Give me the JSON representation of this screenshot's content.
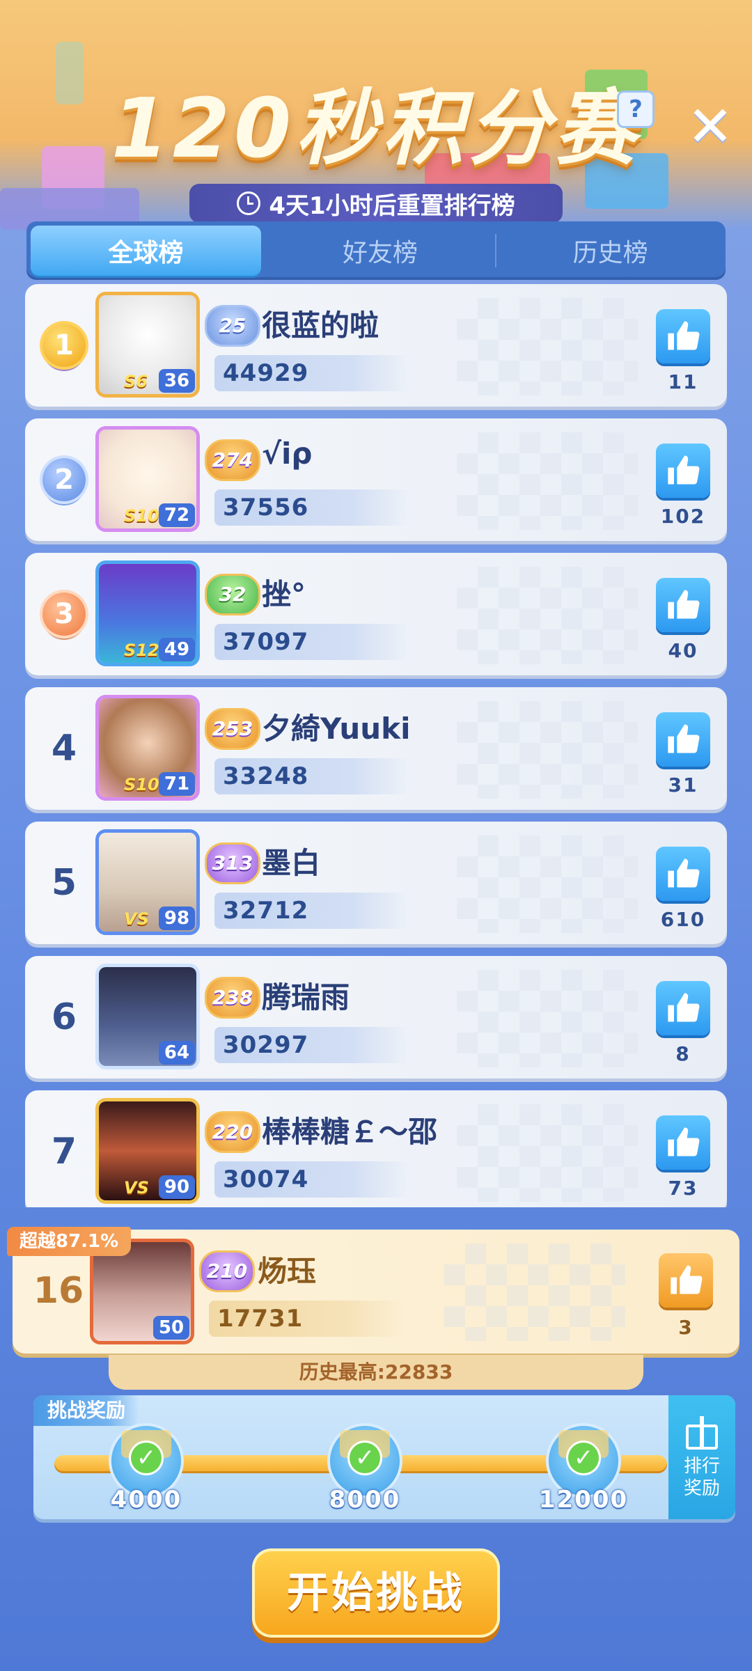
{
  "header": {
    "title": "120秒积分赛",
    "help_label": "?",
    "close_label": "✕",
    "reset_text": "4天1小时后重置排行榜"
  },
  "tabs": [
    {
      "label": "全球榜",
      "active": true
    },
    {
      "label": "好友榜",
      "active": false
    },
    {
      "label": "历史榜",
      "active": false
    }
  ],
  "leaderboard": [
    {
      "rank": "1",
      "medal": "gold",
      "level": "36",
      "season": "S6",
      "badge": "25",
      "badge_color": "blue",
      "name": "很蓝的啦",
      "score": "44929",
      "likes": "11"
    },
    {
      "rank": "2",
      "medal": "silver",
      "level": "72",
      "season": "S10",
      "badge": "274",
      "badge_color": "gold",
      "name": "√iρ",
      "score": "37556",
      "likes": "102"
    },
    {
      "rank": "3",
      "medal": "bronze",
      "level": "49",
      "season": "S12",
      "badge": "32",
      "badge_color": "green",
      "name": "挫°",
      "score": "37097",
      "likes": "40"
    },
    {
      "rank": "4",
      "medal": "",
      "level": "71",
      "season": "S10",
      "badge": "253",
      "badge_color": "gold",
      "name": "夕綺Yuuki",
      "score": "33248",
      "likes": "31"
    },
    {
      "rank": "5",
      "medal": "",
      "level": "98",
      "season": "VS",
      "badge": "313",
      "badge_color": "purple",
      "name": "墨白",
      "score": "32712",
      "likes": "610"
    },
    {
      "rank": "6",
      "medal": "",
      "level": "64",
      "season": "",
      "badge": "238",
      "badge_color": "gold",
      "name": "腾瑞雨",
      "score": "30297",
      "likes": "8"
    },
    {
      "rank": "7",
      "medal": "",
      "level": "90",
      "season": "VS",
      "badge": "220",
      "badge_color": "gold",
      "name": "棒棒糖￡～邵",
      "score": "30074",
      "likes": "73"
    }
  ],
  "me": {
    "surpass": "超越87.1%",
    "rank": "16",
    "level": "50",
    "badge": "210",
    "name": "炀珏",
    "score": "17731",
    "likes": "3",
    "history_best": "历史最高:22833"
  },
  "rewards": {
    "title": "挑战奖励",
    "milestones": [
      "4000",
      "8000",
      "12000"
    ],
    "rank_reward_line1": "排行",
    "rank_reward_line2": "奖励"
  },
  "start_button": "开始挑战",
  "colors": {
    "accent_blue": "#2d99f0",
    "start_orange": "#f7a51c",
    "name_text": "#2a3f78"
  }
}
